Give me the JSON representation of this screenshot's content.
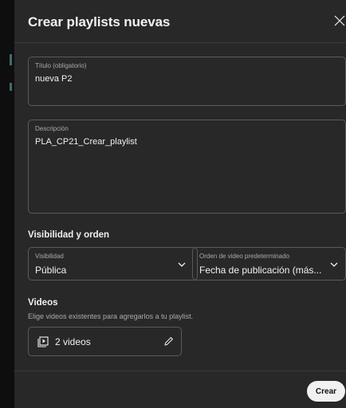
{
  "dialog": {
    "title": "Crear playlists nuevas"
  },
  "title_field": {
    "label": "Título (obligatorio)",
    "value": "nueva P2"
  },
  "description_field": {
    "label": "Descripción",
    "value": "PLA_CP21_Crear_playlist"
  },
  "visibility_section": {
    "heading": "Visibilidad y orden",
    "visibility": {
      "label": "Visibilidad",
      "value": "Pública"
    },
    "order": {
      "label": "Orden de video predeterminado",
      "value": "Fecha de publicación (más..."
    }
  },
  "videos_section": {
    "heading": "Videos",
    "hint": "Elige videos existentes para agregarlos a tu playlist.",
    "count_label": "2 videos"
  },
  "footer": {
    "create_label": "Crear"
  },
  "colors": {
    "dialog_bg": "#282828",
    "field_border": "#5a5a5a",
    "create_button_bg": "#f1f1f1"
  },
  "icons": [
    "close-icon",
    "chevron-down-icon",
    "video-library-icon",
    "pencil-icon"
  ]
}
